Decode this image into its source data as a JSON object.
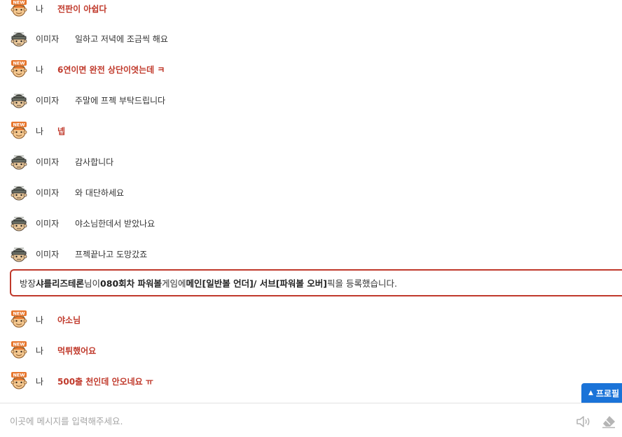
{
  "messages": [
    {
      "kind": "me",
      "icon": "new-badge-avatar-icon",
      "name": "나",
      "text": "전판이 아쉽다"
    },
    {
      "kind": "other",
      "icon": "helmet-avatar-icon",
      "name": "이미자",
      "text": "일하고 저녁에 조금씩 해요"
    },
    {
      "kind": "me",
      "icon": "new-badge-avatar-icon",
      "name": "나",
      "text": "6연이면 완전 상단이엿는데 ㅋ"
    },
    {
      "kind": "other",
      "icon": "helmet-avatar-icon",
      "name": "이미자",
      "text": "주말에 프젝 부탁드립니다"
    },
    {
      "kind": "me",
      "icon": "new-badge-avatar-icon",
      "name": "나",
      "text": "넵"
    },
    {
      "kind": "other",
      "icon": "helmet-avatar-icon",
      "name": "이미자",
      "text": "감사합니다"
    },
    {
      "kind": "other",
      "icon": "helmet-avatar-icon",
      "name": "이미자",
      "text": "와 대단하세요"
    },
    {
      "kind": "other",
      "icon": "helmet-avatar-icon",
      "name": "이미자",
      "text": "야소님한데서 받았나요"
    },
    {
      "kind": "other",
      "icon": "helmet-avatar-icon",
      "name": "이미자",
      "text": "프젝끝나고 도망갔죠"
    },
    {
      "kind": "me",
      "icon": "new-badge-avatar-icon",
      "name": "나",
      "text": "야소님"
    },
    {
      "kind": "me",
      "icon": "new-badge-avatar-icon",
      "name": "나",
      "text": "먹튀했어요"
    },
    {
      "kind": "me",
      "icon": "new-badge-avatar-icon",
      "name": "나",
      "text": "500출 천인데 안오네요 ㅠ"
    }
  ],
  "notice": {
    "p1": "방장 ",
    "host": "샤를리즈테론",
    "p2": "님이 ",
    "round": "080회차 파워볼",
    "p3": " 게임에 ",
    "main_pick": "메인[일반볼 언더]/ 서브[파워볼 오버]",
    "p4": " 픽을 등록했습니다."
  },
  "profile_button": {
    "label": "프로필"
  },
  "input": {
    "placeholder": "이곳에 메시지를 입력해주세요."
  },
  "icons": {
    "sound": "speaker-icon",
    "erase": "eraser-icon",
    "profile": "up-triangle-icon"
  },
  "colors": {
    "accent_red": "#c0392b",
    "profile_blue": "#1a73d8",
    "notice_border": "#c0392b"
  }
}
